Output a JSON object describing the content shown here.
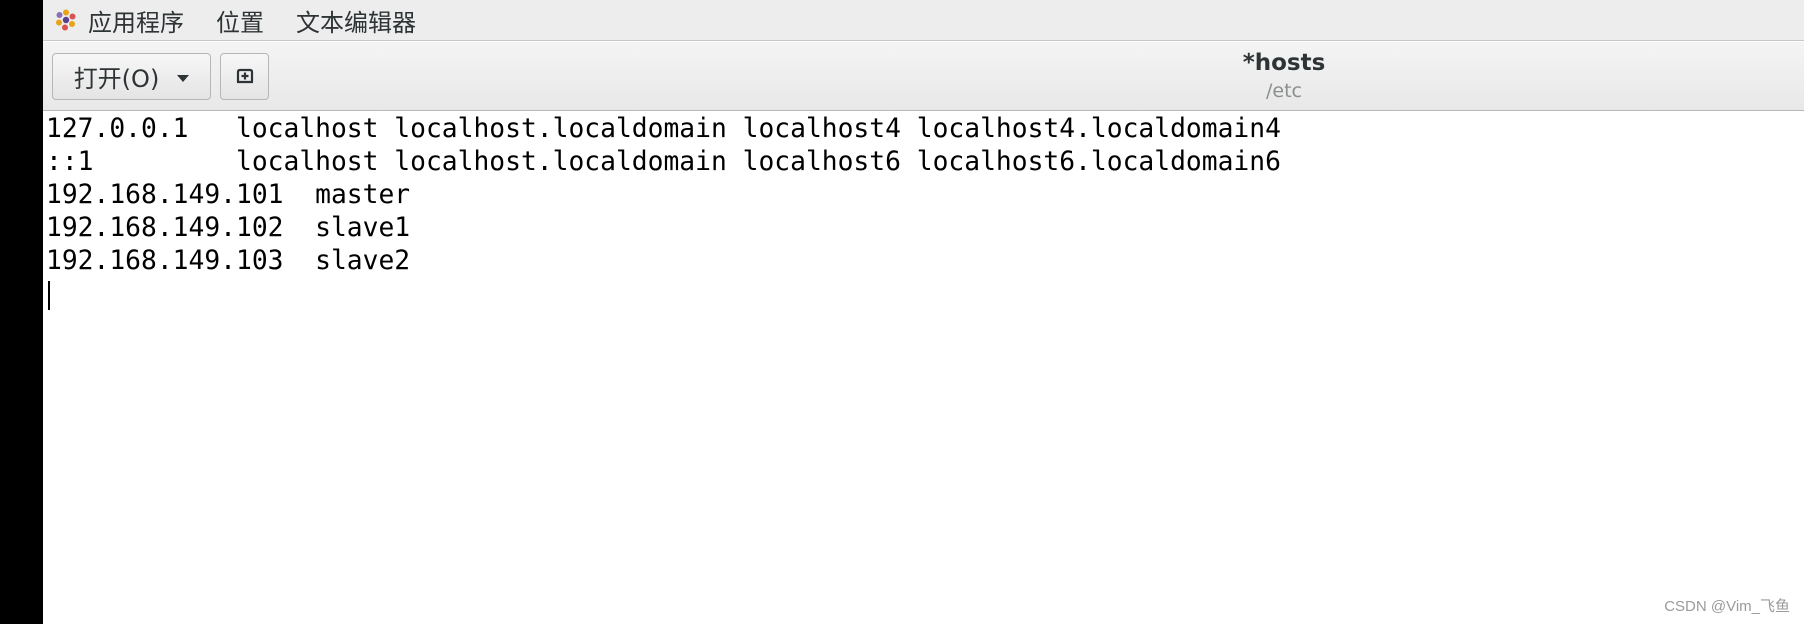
{
  "topbar": {
    "menu": [
      "应用程序",
      "位置",
      "文本编辑器"
    ]
  },
  "toolbar": {
    "open_label": "打开(O)"
  },
  "document": {
    "title": "*hosts",
    "path": "/etc",
    "lines": [
      "127.0.0.1   localhost localhost.localdomain localhost4 localhost4.localdomain4",
      "::1         localhost localhost.localdomain localhost6 localhost6.localdomain6",
      "192.168.149.101  master",
      "192.168.149.102  slave1",
      "192.168.149.103  slave2"
    ]
  },
  "watermark": "CSDN @Vim_飞鱼",
  "icons": {
    "apps": "gnome-foot-icon",
    "new_tab": "new-document-tab-icon",
    "dropdown": "chevron-down-icon"
  }
}
